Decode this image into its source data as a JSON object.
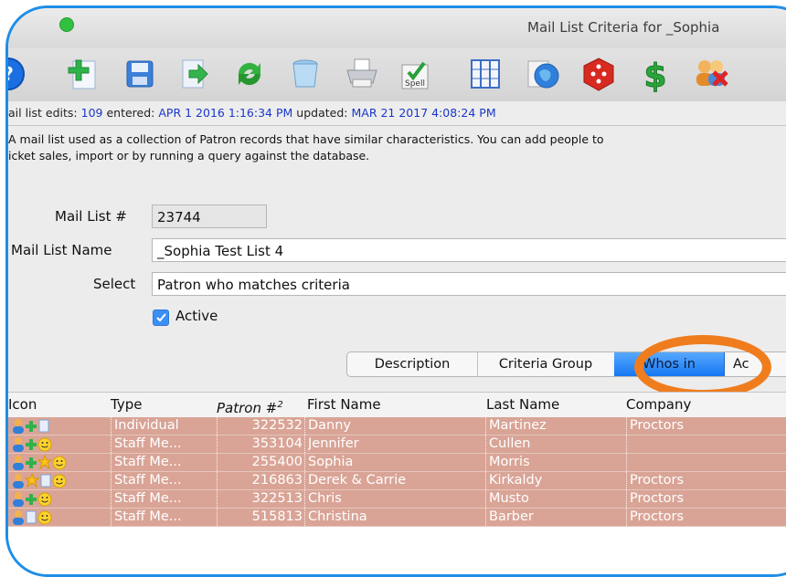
{
  "window": {
    "title": "Mail List Criteria for _Sophia"
  },
  "toolbar": {
    "buttons": [
      "help-icon",
      "add-icon",
      "save-icon",
      "export-icon",
      "refresh-icon",
      "trash-icon",
      "print-icon",
      "spell-check-icon",
      "columns-icon",
      "globe-icon",
      "dice-icon",
      "dollar-icon",
      "remove-people-icon"
    ],
    "spell_label": "Spell"
  },
  "info": {
    "edits_label": "ail list edits:",
    "edits_value": "109",
    "entered_label": "entered:",
    "entered_value": "APR 1 2016 1:16:34 PM",
    "updated_label": "updated:",
    "updated_value": "MAR 21 2017 4:08:24 PM"
  },
  "description": {
    "line1": "A mail list used as a collection of Patron records that have similar characteristics.  You can add people to",
    "line2": "icket sales, import or by running a query against the database."
  },
  "form": {
    "mail_list_no_label": "Mail List #",
    "mail_list_no": "23744",
    "mail_list_name_label": "Mail List Name",
    "mail_list_name": "_Sophia Test List 4",
    "select_label": "Select",
    "select_value": "Patron who matches criteria",
    "active_label": "Active"
  },
  "tabs": [
    "Description",
    "Criteria Group",
    "Whos in",
    "Ac"
  ],
  "selected_tab": "Whos in",
  "table": {
    "columns": [
      "Icon",
      "Type",
      "Patron #",
      "First Name",
      "Last Name",
      "Company"
    ],
    "patron_sup": "2",
    "rows": [
      {
        "type": "Individual",
        "patron": "322532",
        "first": "Danny",
        "last": "Martinez",
        "company": "Proctors"
      },
      {
        "type": "Staff Me...",
        "patron": "353104",
        "first": "Jennifer",
        "last": "Cullen",
        "company": ""
      },
      {
        "type": "Staff Me...",
        "patron": "255400",
        "first": "Sophia",
        "last": "Morris",
        "company": ""
      },
      {
        "type": "Staff Me...",
        "patron": "216863",
        "first": "Derek & Carrie",
        "last": "Kirkaldy",
        "company": "Proctors"
      },
      {
        "type": "Staff Me...",
        "patron": "322513",
        "first": "Chris",
        "last": "Musto",
        "company": "Proctors"
      },
      {
        "type": "Staff Me...",
        "patron": "515813",
        "first": "Christina",
        "last": "Barber",
        "company": "Proctors"
      }
    ]
  },
  "colors": {
    "accent": "#1e8ee6",
    "highlight": "#ef7d1e",
    "row_bg": "#d9a496",
    "tab_selected": "#1677f2"
  }
}
